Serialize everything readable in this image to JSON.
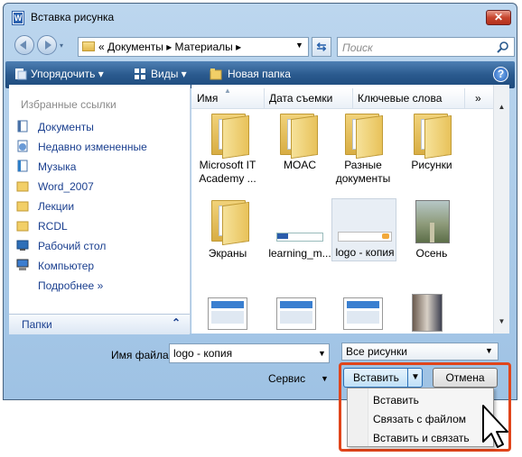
{
  "window": {
    "title": "Вставка рисунка",
    "close_glyph": "✕",
    "icon_letter": "W"
  },
  "address": {
    "history_glyph": "▾",
    "path": "«  Документы ▸ Материалы ▸",
    "refresh_glyph": "⇆"
  },
  "search": {
    "placeholder": "Поиск"
  },
  "toolbar": {
    "organize": "Упорядочить ▾",
    "views": "Виды ▾",
    "new_folder": "Новая папка",
    "help_glyph": "?"
  },
  "favorites": {
    "header": "Избранные ссылки",
    "items": [
      {
        "label": "Документы",
        "icon": "documents-icon"
      },
      {
        "label": "Недавно измененные",
        "icon": "recent-icon"
      },
      {
        "label": "Музыка",
        "icon": "music-icon"
      },
      {
        "label": "Word_2007",
        "icon": "folder-icon"
      },
      {
        "label": "Лекции",
        "icon": "folder-icon"
      },
      {
        "label": "RCDL",
        "icon": "folder-icon"
      },
      {
        "label": "Рабочий стол",
        "icon": "desktop-icon"
      },
      {
        "label": "Компьютер",
        "icon": "computer-icon"
      },
      {
        "label": "Подробнее »",
        "icon": ""
      }
    ],
    "folders_label": "Папки",
    "folders_chevron": "⌃"
  },
  "columns": [
    "Имя",
    "Дата съемки",
    "Ключевые слова",
    "»"
  ],
  "files": [
    {
      "name": "Microsoft IT Academy ...",
      "type": "folder"
    },
    {
      "name": "MOAC",
      "type": "folder"
    },
    {
      "name": "Разные документы",
      "type": "folder"
    },
    {
      "name": "Рисунки",
      "type": "folder"
    },
    {
      "name": "Экраны",
      "type": "folder"
    },
    {
      "name": "learning_m...",
      "type": "image"
    },
    {
      "name": "logo - копия",
      "type": "image"
    },
    {
      "name": "Осень",
      "type": "image"
    }
  ],
  "bottom": {
    "filename_label": "Имя файла:",
    "filename_value": "logo - копия",
    "filter_value": "Все рисунки",
    "service_label": "Сервис",
    "insert_label": "Вставить",
    "cancel_label": "Отмена"
  },
  "insert_menu": [
    "Вставить",
    "Связать с файлом",
    "Вставить и связать"
  ],
  "colors": {
    "highlight": "#e0451b",
    "toolbar": "#2a5a8e",
    "link": "#1a3f8f"
  }
}
